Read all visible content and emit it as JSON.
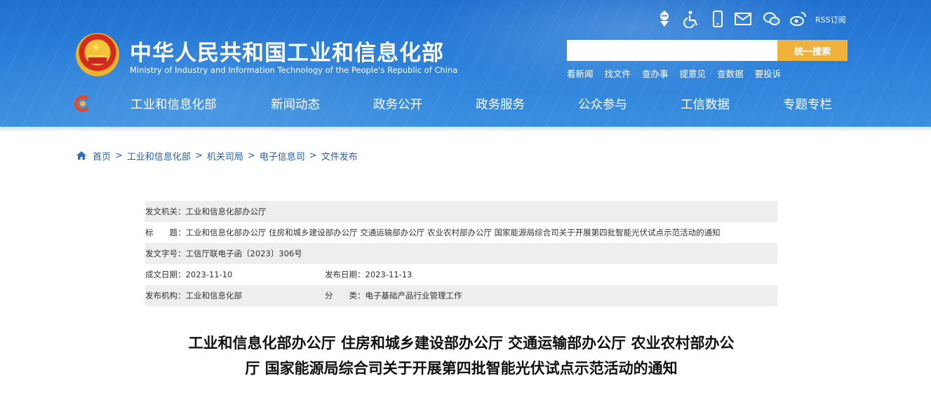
{
  "header": {
    "title": "中华人民共和国工业和信息化部",
    "subtitle": "Ministry of Industry and Information Technology of the People's Republic of China",
    "rss_label": "RSS订阅",
    "icons": [
      "robot-assistant-icon",
      "accessibility-icon",
      "mobile-icon",
      "mail-icon",
      "wechat-icon",
      "weibo-icon"
    ],
    "colors": {
      "header_blue": "#2b7fd9",
      "search_button": "#f0b23c",
      "link_blue": "#2a5fa7"
    }
  },
  "search": {
    "placeholder": "",
    "value": "",
    "button_label": "统一搜索"
  },
  "quick_links": [
    "看新闻",
    "找文件",
    "查办事",
    "提意见",
    "查数据",
    "要投诉"
  ],
  "nav": [
    "工业和信息化部",
    "新闻动态",
    "政务公开",
    "政务服务",
    "公众参与",
    "工信数据",
    "专题专栏"
  ],
  "breadcrumb": [
    "首页",
    "工业和信息化部",
    "机关司局",
    "电子信息司",
    "文件发布"
  ],
  "info": {
    "issuer_label": "发文机关：",
    "issuer": "工业和信息化部办公厅",
    "title_label": "标　　题：",
    "title": "工业和信息化部办公厅 住房和城乡建设部办公厅 交通运输部办公厅 农业农村部办公厅 国家能源局综合司关于开展第四批智能光伏试点示范活动的通知",
    "doc_no_label": "发文字号：",
    "doc_no": "工信厅联电子函〔2023〕306号",
    "written_date_label": "成文日期：",
    "written_date": "2023-11-10",
    "publish_date_label": "发布日期：",
    "publish_date": "2023-11-13",
    "publisher_label": "发布机构：",
    "publisher": "工业和信息化部",
    "category_label": "分　　类：",
    "category": "电子基础产品行业管理工作"
  },
  "article": {
    "title_line1": "工业和信息化部办公厅 住房和城乡建设部办公厅 交通运输部办公厅 农业农村部办公",
    "title_line2": "厅 国家能源局综合司关于开展第四批智能光伏试点示范活动的通知"
  }
}
